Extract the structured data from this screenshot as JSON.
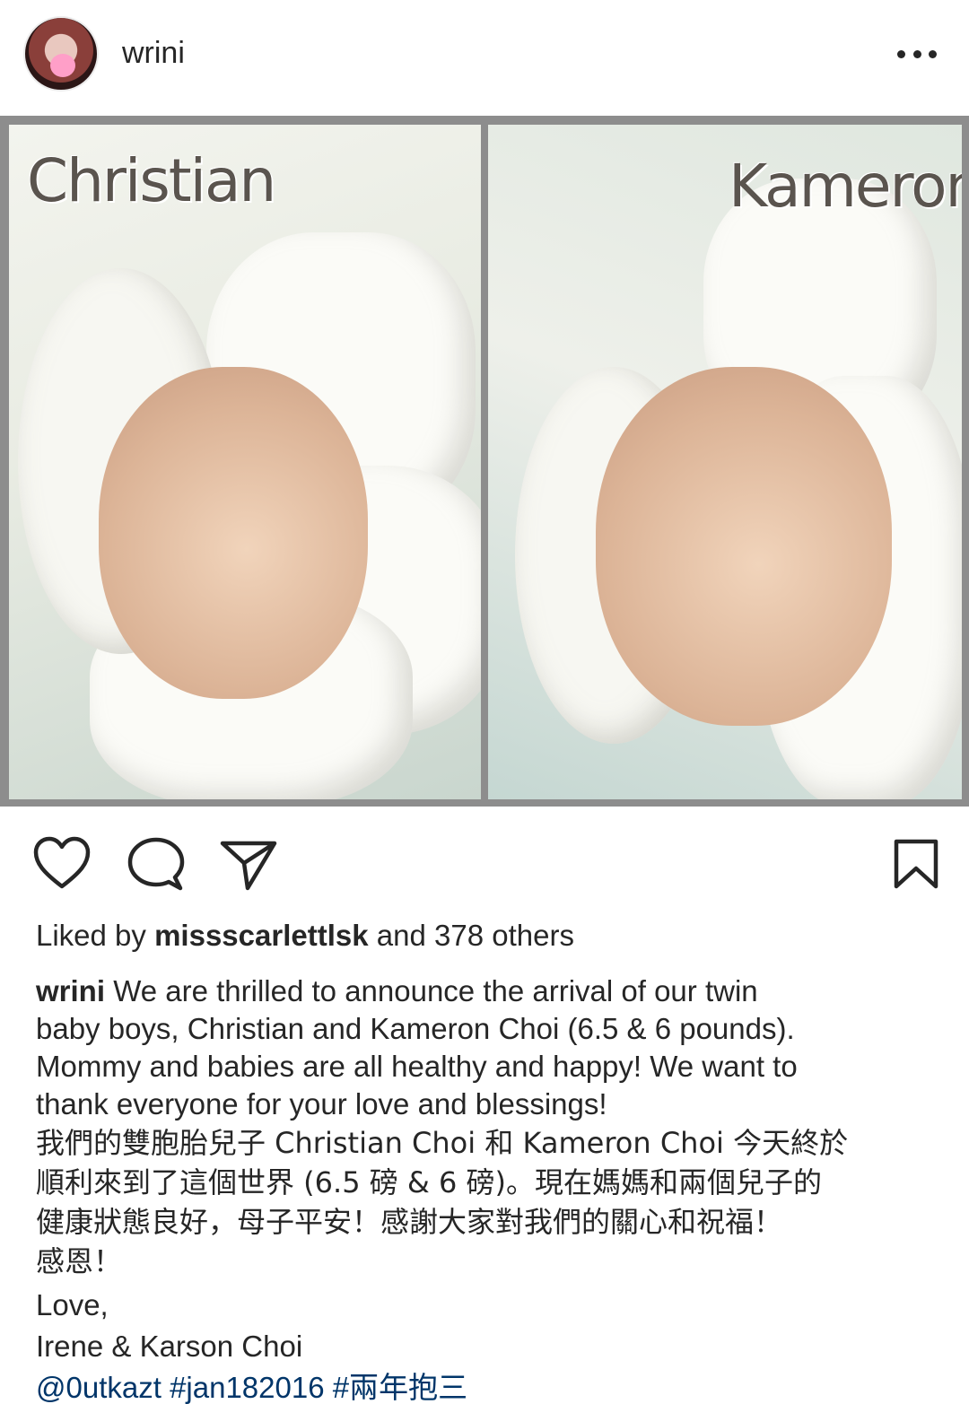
{
  "header": {
    "username": "wrini"
  },
  "photo": {
    "left_name": "Christian",
    "right_name": "Kameron"
  },
  "likes": {
    "prefix": "Liked by",
    "user": "missscarlettlsk",
    "suffix": "and 378 others"
  },
  "caption": {
    "username": "wrini",
    "en_lines": [
      "We are thrilled to announce the arrival of our twin",
      "baby boys, Christian and Kameron Choi (6.5 & 6 pounds).",
      "Mommy and babies are all healthy and happy! We want to",
      "thank everyone for your love and blessings!"
    ],
    "zh_lines": [
      "我們的雙胞胎兒子 Christian Choi 和 Kameron Choi 今天終於",
      "順利來到了這個世界 (6.5 磅 & 6 磅)。現在媽媽和兩個兒子的",
      "健康狀態良好，母子平安！感謝大家對我們的關心和祝福！",
      "感恩！"
    ],
    "sign_off": "Love,",
    "signature": "Irene & Karson Choi",
    "tags": "@0utkazt #jan182016 #兩年抱三"
  },
  "icons": {
    "more": "more-horizontal-icon",
    "like": "heart-icon",
    "comment": "comment-icon",
    "share": "send-icon",
    "save": "bookmark-icon"
  },
  "colors": {
    "text": "#262626",
    "hashtag": "#003569",
    "photo_border": "#8d8d8d"
  }
}
